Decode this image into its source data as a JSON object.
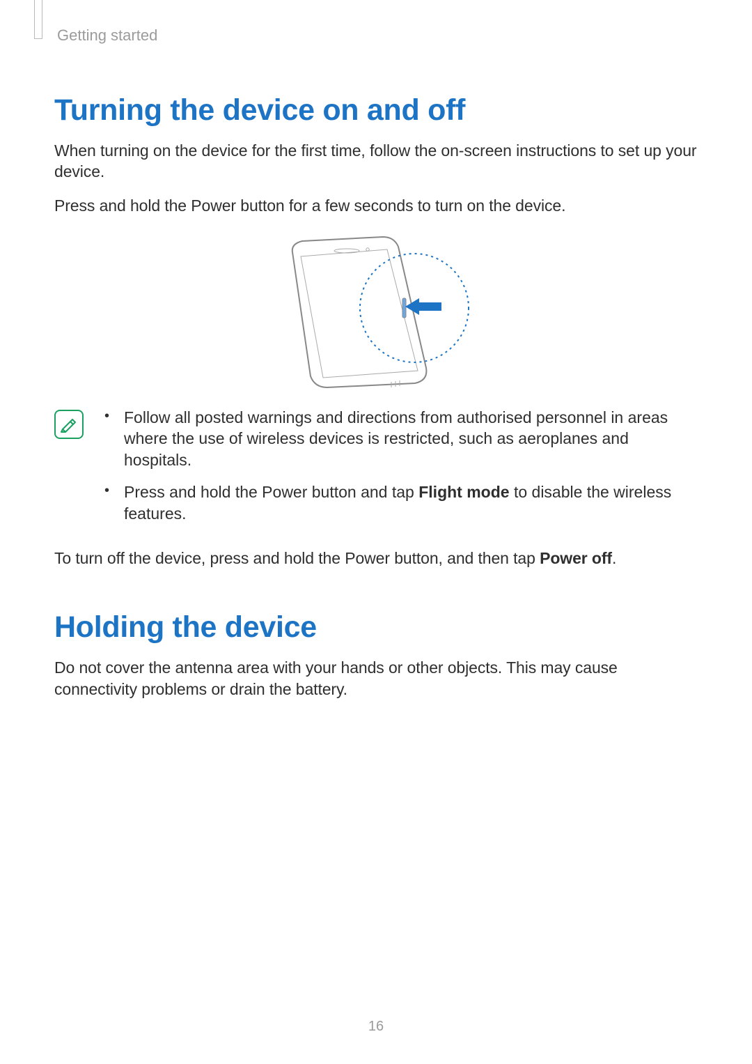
{
  "breadcrumb": "Getting started",
  "section1": {
    "heading": "Turning the device on and off",
    "para1": "When turning on the device for the first time, follow the on-screen instructions to set up your device.",
    "para2": "Press and hold the Power button for a few seconds to turn on the device.",
    "notice": {
      "items": [
        {
          "text": "Follow all posted warnings and directions from authorised personnel in areas where the use of wireless devices is restricted, such as aeroplanes and hospitals."
        },
        {
          "prefix": "Press and hold the Power button and tap ",
          "bold": "Flight mode",
          "suffix": " to disable the wireless features."
        }
      ]
    },
    "para3_prefix": "To turn off the device, press and hold the Power button, and then tap ",
    "para3_bold": "Power off",
    "para3_suffix": "."
  },
  "section2": {
    "heading": "Holding the device",
    "para1": "Do not cover the antenna area with your hands or other objects. This may cause connectivity problems or drain the battery."
  },
  "pageNumber": "16"
}
